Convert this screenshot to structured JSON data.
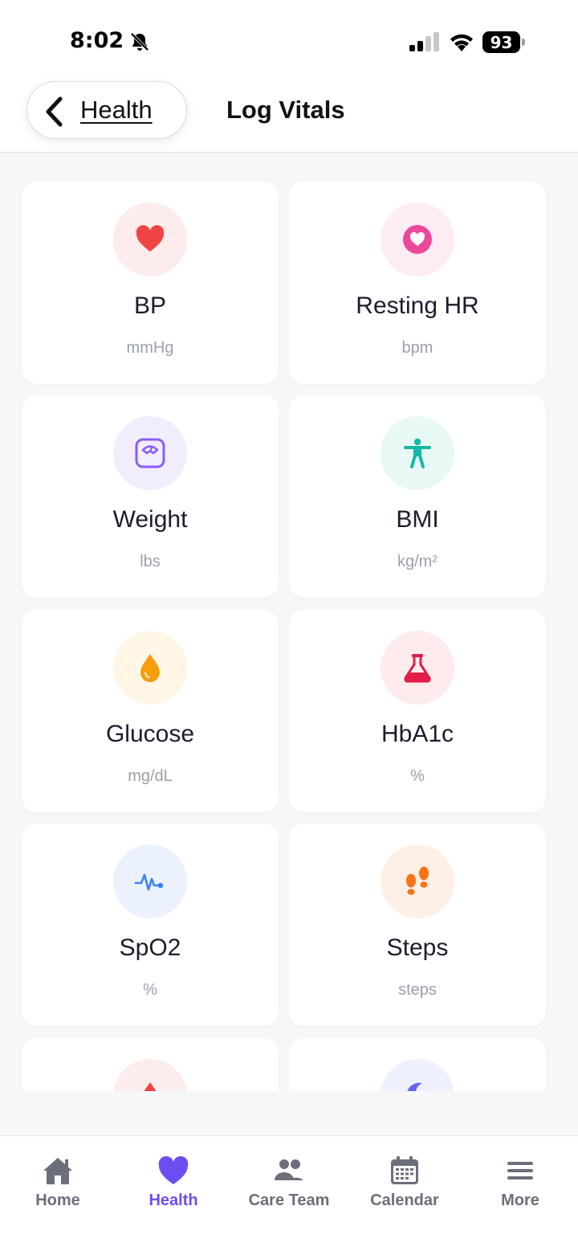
{
  "status_bar": {
    "time": "8:02",
    "battery": "93"
  },
  "header": {
    "back_label": "Health",
    "title": "Log Vitals"
  },
  "vitals": [
    {
      "title": "BP",
      "unit": "mmHg",
      "icon": "heart-icon",
      "color": "#ef4444",
      "bg": "#fdecec"
    },
    {
      "title": "Resting HR",
      "unit": "bpm",
      "icon": "heart-circle-icon",
      "color": "#ec4899",
      "bg": "#fdecf3"
    },
    {
      "title": "Weight",
      "unit": "lbs",
      "icon": "scale-icon",
      "color": "#8b5cf6",
      "bg": "#f1edfd"
    },
    {
      "title": "BMI",
      "unit": "kg/m²",
      "icon": "person-icon",
      "color": "#14b8a6",
      "bg": "#e8f8f4"
    },
    {
      "title": "Glucose",
      "unit": "mg/dL",
      "icon": "drop-icon",
      "color": "#f59e0b",
      "bg": "#fff6e6"
    },
    {
      "title": "HbA1c",
      "unit": "%",
      "icon": "flask-icon",
      "color": "#e11d48",
      "bg": "#fdebee"
    },
    {
      "title": "SpO2",
      "unit": "%",
      "icon": "pulse-icon",
      "color": "#3b82f6",
      "bg": "#ebf2fe"
    },
    {
      "title": "Steps",
      "unit": "steps",
      "icon": "footprints-icon",
      "color": "#f97316",
      "bg": "#fef0e6"
    }
  ],
  "tabs": [
    {
      "label": "Home",
      "icon": "home-icon"
    },
    {
      "label": "Health",
      "icon": "heart-icon",
      "active": true
    },
    {
      "label": "Care Team",
      "icon": "people-icon"
    },
    {
      "label": "Calendar",
      "icon": "calendar-icon"
    },
    {
      "label": "More",
      "icon": "menu-icon"
    }
  ],
  "colors": {
    "accent": "#6e4df0",
    "tab_inactive": "#6b6f7b"
  }
}
